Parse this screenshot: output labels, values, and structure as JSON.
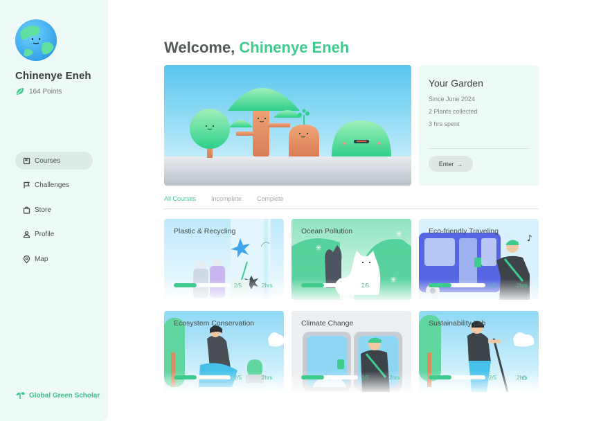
{
  "user": {
    "name": "Chinenye Eneh",
    "points": "164 Points"
  },
  "nav": [
    {
      "label": "Courses",
      "icon": "book-icon",
      "active": true
    },
    {
      "label": "Challenges",
      "icon": "flag-icon",
      "active": false
    },
    {
      "label": "Store",
      "icon": "bag-icon",
      "active": false
    },
    {
      "label": "Profile",
      "icon": "user-icon",
      "active": false
    },
    {
      "label": "Map",
      "icon": "map-pin-icon",
      "active": false
    }
  ],
  "brand": {
    "name": "Global Green Scholar"
  },
  "welcome": {
    "prefix": "Welcome, ",
    "name": "Chinenye Eneh"
  },
  "garden": {
    "title": "Your Garden",
    "since": "Since June 2024",
    "plants": "2 Plants collected",
    "time": "3 hrs spent",
    "enter_label": "Enter",
    "enter_icon": "→"
  },
  "tabs": [
    {
      "label": "All Courses",
      "active": true
    },
    {
      "label": "Incomplete",
      "active": false
    },
    {
      "label": "Complete",
      "active": false
    }
  ],
  "courses": [
    {
      "title": "Plastic & Recycling",
      "progress": "2/5",
      "progress_fraction": 0.4,
      "time": "2hrs"
    },
    {
      "title": "Ocean Pollution",
      "progress": "2/5",
      "progress_fraction": 0.4,
      "time": ""
    },
    {
      "title": "Eco-friendly Traveling",
      "progress": "2/5",
      "progress_fraction": 0.4,
      "time": "2hrs"
    },
    {
      "title": "Ecosystem Conservation",
      "progress": "2/5",
      "progress_fraction": 0.4,
      "time": "2hrs"
    },
    {
      "title": "Climate Change",
      "progress": "2/5",
      "progress_fraction": 0.4,
      "time": "2hrs"
    },
    {
      "title": "Sustainability Lab",
      "progress": "2/5",
      "progress_fraction": 0.4,
      "time": "2hrs"
    }
  ],
  "colors": {
    "accent": "#3fca8e",
    "sidebar_bg": "#edfaf8",
    "text": "#3a3d3d"
  }
}
